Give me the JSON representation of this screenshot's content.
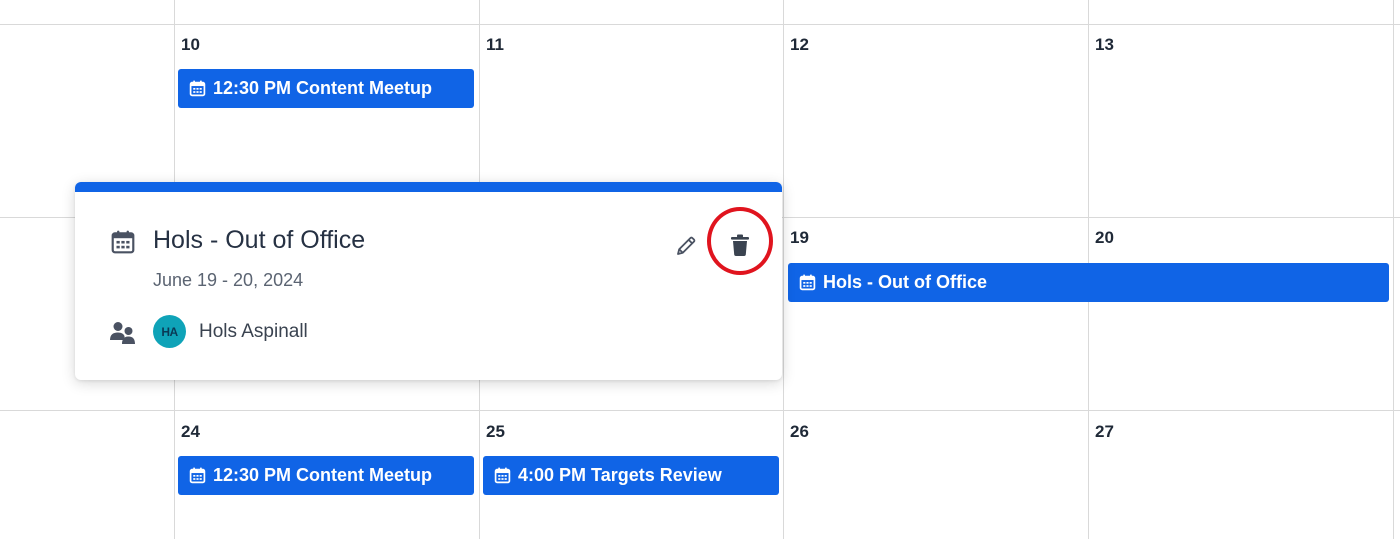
{
  "calendar": {
    "weeks": [
      {
        "days": [
          "",
          "10",
          "11",
          "12",
          "13"
        ]
      },
      {
        "days": [
          "",
          "",
          "",
          "19",
          "20"
        ]
      },
      {
        "days": [
          "",
          "24",
          "25",
          "26",
          "27"
        ]
      }
    ],
    "events": [
      {
        "time": "12:30 PM",
        "title": "Content Meetup",
        "icon": "calendar-icon"
      },
      {
        "time": "",
        "title": "Hols - Out of Office",
        "icon": "calendar-icon"
      },
      {
        "time": "12:30 PM",
        "title": "Content Meetup",
        "icon": "calendar-icon"
      },
      {
        "time": "4:00 PM",
        "title": "Targets Review",
        "icon": "calendar-icon"
      }
    ]
  },
  "popover": {
    "title": "Hols - Out of Office",
    "date_range": "June 19 - 20, 2024",
    "attendee": {
      "initials": "HA",
      "name": "Hols Aspinall"
    },
    "actions": {
      "edit_icon": "pencil-icon",
      "delete_icon": "trash-icon"
    }
  },
  "colors": {
    "event_blue": "#1064e6",
    "highlight_red": "#e0141e",
    "avatar_teal": "#0fa3b8",
    "grid_line": "#d9d9d9"
  }
}
